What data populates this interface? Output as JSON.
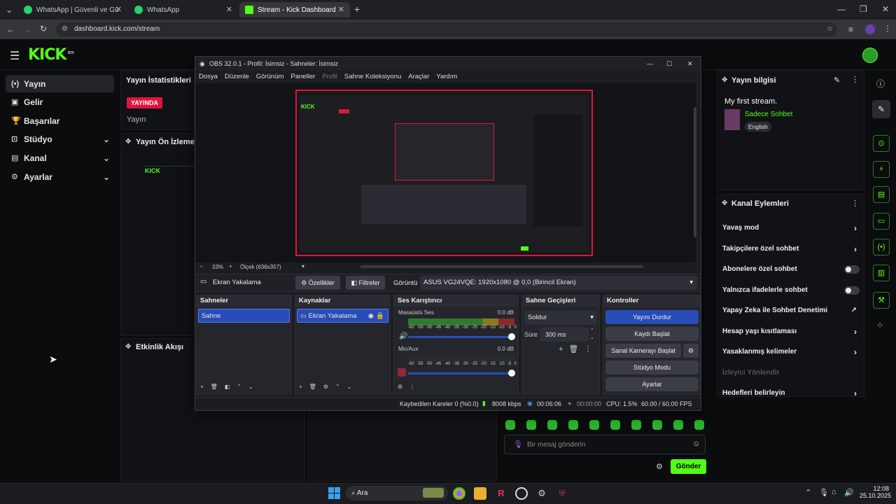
{
  "browser": {
    "tabs": [
      {
        "title": "WhatsApp | Güvenli ve Güvenli"
      },
      {
        "title": "WhatsApp"
      },
      {
        "title": "Stream - Kick Dashboard"
      }
    ],
    "url": "dashboard.kick.com/stream",
    "new_tab": "+"
  },
  "kick": {
    "logo": "KICK",
    "logo_badge": "BETA",
    "nav": [
      {
        "label": "Yayın",
        "icon": "broadcast-icon"
      },
      {
        "label": "Gelir",
        "icon": "wallet-icon"
      },
      {
        "label": "Başarılar",
        "icon": "trophy-icon"
      },
      {
        "label": "Stüdyo",
        "icon": "studio-icon"
      },
      {
        "label": "Kanal",
        "icon": "channel-icon"
      },
      {
        "label": "Ayarlar",
        "icon": "gear-icon"
      }
    ],
    "stats_title": "Yayın İstatistikleri",
    "live_badge": "YAYINDA",
    "stats_label": "Yayın",
    "preview_title": "Yayın Ön İzlemesi",
    "activity_title": "Etkinlik Akışı",
    "stream_info": {
      "title": "Yayın bilgisi",
      "stream_name": "My first stream.",
      "category": "Sadece Sohbet",
      "language": "English"
    },
    "channel_actions": {
      "title": "Kanal Eylemleri",
      "items": [
        {
          "label": "Yavaş mod",
          "control": "chevron"
        },
        {
          "label": "Takipçilere özel sohbet",
          "control": "chevron"
        },
        {
          "label": "Abonelere özel sohbet",
          "control": "toggle"
        },
        {
          "label": "Yalnızca ifadelerle sohbet",
          "control": "toggle"
        },
        {
          "label": "Yapay Zeka ile Sohbet Denetimi",
          "control": "external"
        },
        {
          "label": "Hesap yaşı kısıtlaması",
          "control": "chevron"
        },
        {
          "label": "Yasaklanmış kelimeler",
          "control": "chevron"
        },
        {
          "label": "İzleyici Yönlendir",
          "control": "disabled"
        },
        {
          "label": "Hedefleri belirleyin",
          "control": "chevron"
        }
      ]
    },
    "chat": {
      "placeholder": "Bir mesaj gönderin",
      "send": "Gönder"
    }
  },
  "obs": {
    "title": "OBS 32.0.1 - Profil: İsimsiz - Sahneler: İsimsiz",
    "menu": [
      "Dosya",
      "Düzenle",
      "Görünüm",
      "Paneller",
      "Profil",
      "Sahne Koleksiyonu",
      "Araçlar",
      "Yardım"
    ],
    "zoom": "33%",
    "scale": "Ölçek (636x357)",
    "source_bar": {
      "name": "Ekran Yakalama",
      "properties": "Özellikler",
      "filters": "Filtreler",
      "display_label": "Görüntü",
      "display_value": "ASUS VG24VQE: 1920x1080 @ 0,0 (Birincil Ekran)"
    },
    "scenes": {
      "title": "Sahneler",
      "items": [
        "Sahne"
      ]
    },
    "sources": {
      "title": "Kaynaklar",
      "items": [
        "Ekran Yakalama"
      ]
    },
    "mixer": {
      "title": "Ses Karıştırıcı",
      "channels": [
        {
          "name": "Masaüstü Ses",
          "db": "0.0 dB"
        },
        {
          "name": "Mic/Aux",
          "db": "0.0 dB"
        }
      ],
      "scale": [
        "-60",
        "-55",
        "-50",
        "-45",
        "-40",
        "-35",
        "-30",
        "-25",
        "-20",
        "-15",
        "-10",
        "-5",
        "0"
      ]
    },
    "transitions": {
      "title": "Sahne Geçişleri",
      "type": "Soldur",
      "duration_label": "Süre",
      "duration": "300 ms"
    },
    "controls": {
      "title": "Kontroller",
      "buttons": [
        "Yayını Durdur",
        "Kaydı Başlat",
        "Sanal Kamerayı Başlat",
        "Stüdyo Modu",
        "Ayarlar"
      ]
    },
    "status": {
      "dropped": "Kaybedilen Kareler 0 (%0.0)",
      "bitrate": "8008 kbps",
      "stream_time": "00:06:06",
      "rec_time": "00:00:00",
      "cpu": "CPU: 1.5%",
      "fps": "60.00 / 60.00 FPS"
    }
  },
  "taskbar": {
    "search": "Ara",
    "time": "12:08",
    "date": "25.10.2025"
  },
  "colors": {
    "kick_green": "#53fc18",
    "live_red": "#e1143c",
    "obs_blue": "#284cb8"
  }
}
